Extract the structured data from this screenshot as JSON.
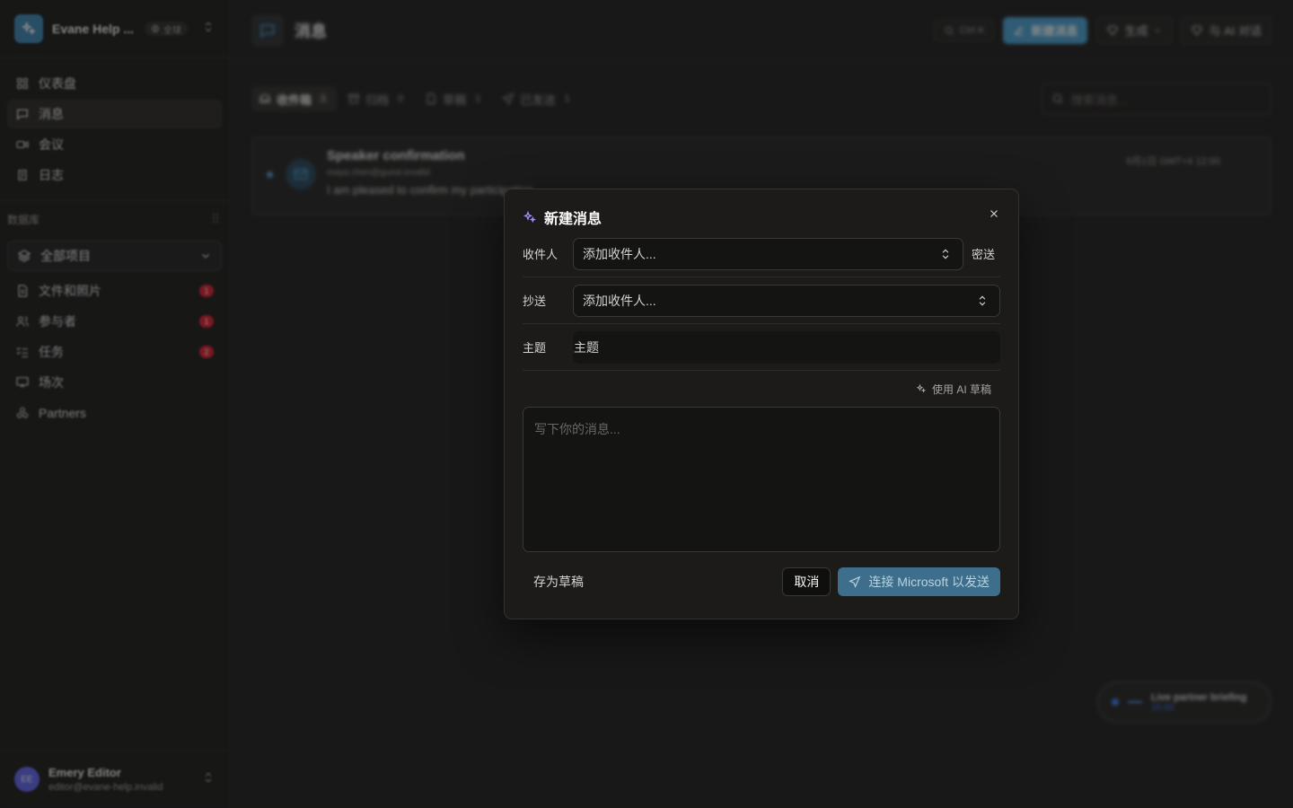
{
  "workspace": {
    "name": "Evane Help ...",
    "scope_badge": "全球",
    "accent": "#3d88b8"
  },
  "nav": [
    {
      "label": "仪表盘",
      "icon": "dashboard-icon"
    },
    {
      "label": "消息",
      "icon": "message-icon",
      "active": true
    },
    {
      "label": "会议",
      "icon": "video-icon"
    },
    {
      "label": "日志",
      "icon": "log-icon"
    }
  ],
  "database": {
    "label": "数据库",
    "selector": "全部项目",
    "items": [
      {
        "label": "文件和照片",
        "badge": "1"
      },
      {
        "label": "参与者",
        "badge": "1"
      },
      {
        "label": "任务",
        "badge": "2"
      },
      {
        "label": "场次",
        "badge": ""
      },
      {
        "label": "Partners",
        "badge": ""
      }
    ]
  },
  "user": {
    "initials": "EE",
    "name": "Emery Editor",
    "email": "editor@evane-help.invalid"
  },
  "header": {
    "title": "消息",
    "shortcut": "Ctrl K",
    "new_message": "新建消息",
    "generate": "生成",
    "ai_chat": "与 AI 对话"
  },
  "tabs": [
    {
      "label": "收件箱",
      "count": "1",
      "active": true
    },
    {
      "label": "归档",
      "count": "0"
    },
    {
      "label": "草稿",
      "count": "1"
    },
    {
      "label": "已发送",
      "count": "1"
    }
  ],
  "search": {
    "placeholder": "搜索消息..."
  },
  "message": {
    "subject": "Speaker confirmation",
    "from": "maya.chen@guest.invalid",
    "preview": "I am pleased to confirm my participation",
    "date": "9月1日 GMT+4 12:00"
  },
  "live": {
    "title": "Live partner briefing",
    "time": "15:00"
  },
  "modal": {
    "title": "新建消息",
    "to_label": "收件人",
    "to_placeholder": "添加收件人...",
    "bcc_label": "密送",
    "cc_label": "抄送",
    "cc_placeholder": "添加收件人...",
    "subject_label": "主题",
    "subject_placeholder": "主题",
    "ai_draft": "使用 AI 草稿",
    "body_placeholder": "写下你的消息...",
    "save_draft": "存为草稿",
    "cancel": "取消",
    "send": "连接 Microsoft 以发送"
  }
}
